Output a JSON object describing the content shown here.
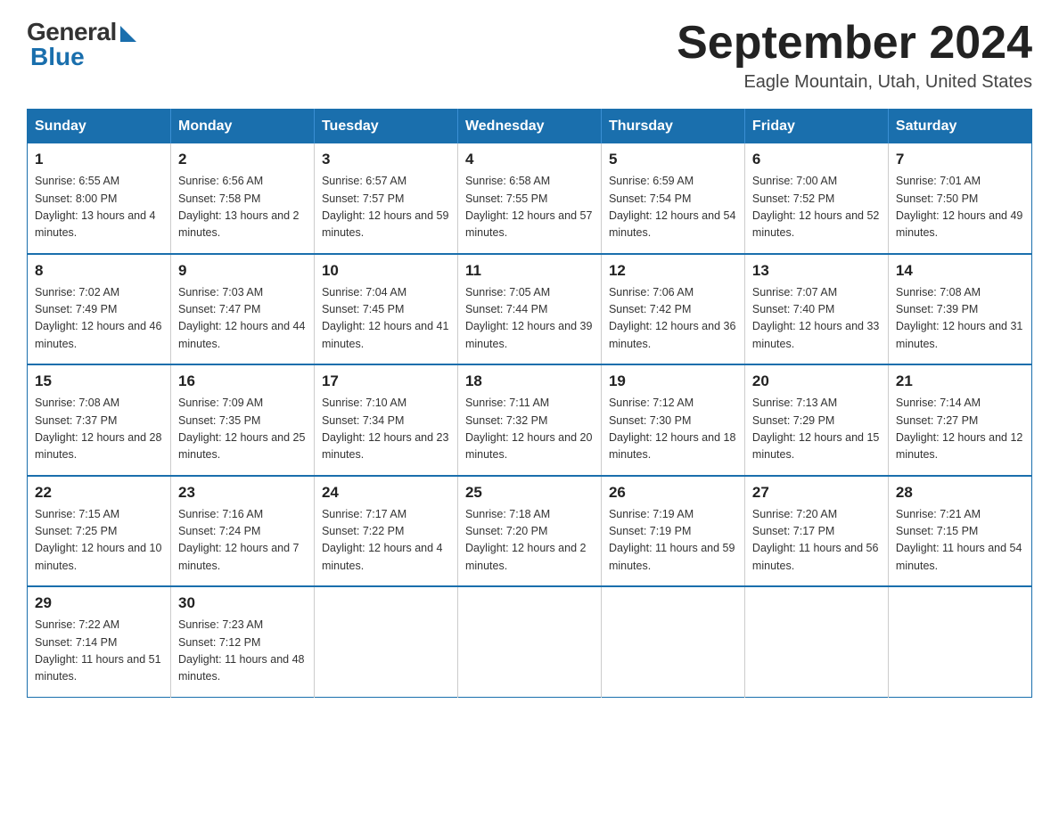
{
  "header": {
    "logo_general": "General",
    "logo_blue": "Blue",
    "month_title": "September 2024",
    "location": "Eagle Mountain, Utah, United States"
  },
  "days_of_week": [
    "Sunday",
    "Monday",
    "Tuesday",
    "Wednesday",
    "Thursday",
    "Friday",
    "Saturday"
  ],
  "weeks": [
    [
      {
        "day": "1",
        "sunrise": "6:55 AM",
        "sunset": "8:00 PM",
        "daylight": "13 hours and 4 minutes."
      },
      {
        "day": "2",
        "sunrise": "6:56 AM",
        "sunset": "7:58 PM",
        "daylight": "13 hours and 2 minutes."
      },
      {
        "day": "3",
        "sunrise": "6:57 AM",
        "sunset": "7:57 PM",
        "daylight": "12 hours and 59 minutes."
      },
      {
        "day": "4",
        "sunrise": "6:58 AM",
        "sunset": "7:55 PM",
        "daylight": "12 hours and 57 minutes."
      },
      {
        "day": "5",
        "sunrise": "6:59 AM",
        "sunset": "7:54 PM",
        "daylight": "12 hours and 54 minutes."
      },
      {
        "day": "6",
        "sunrise": "7:00 AM",
        "sunset": "7:52 PM",
        "daylight": "12 hours and 52 minutes."
      },
      {
        "day": "7",
        "sunrise": "7:01 AM",
        "sunset": "7:50 PM",
        "daylight": "12 hours and 49 minutes."
      }
    ],
    [
      {
        "day": "8",
        "sunrise": "7:02 AM",
        "sunset": "7:49 PM",
        "daylight": "12 hours and 46 minutes."
      },
      {
        "day": "9",
        "sunrise": "7:03 AM",
        "sunset": "7:47 PM",
        "daylight": "12 hours and 44 minutes."
      },
      {
        "day": "10",
        "sunrise": "7:04 AM",
        "sunset": "7:45 PM",
        "daylight": "12 hours and 41 minutes."
      },
      {
        "day": "11",
        "sunrise": "7:05 AM",
        "sunset": "7:44 PM",
        "daylight": "12 hours and 39 minutes."
      },
      {
        "day": "12",
        "sunrise": "7:06 AM",
        "sunset": "7:42 PM",
        "daylight": "12 hours and 36 minutes."
      },
      {
        "day": "13",
        "sunrise": "7:07 AM",
        "sunset": "7:40 PM",
        "daylight": "12 hours and 33 minutes."
      },
      {
        "day": "14",
        "sunrise": "7:08 AM",
        "sunset": "7:39 PM",
        "daylight": "12 hours and 31 minutes."
      }
    ],
    [
      {
        "day": "15",
        "sunrise": "7:08 AM",
        "sunset": "7:37 PM",
        "daylight": "12 hours and 28 minutes."
      },
      {
        "day": "16",
        "sunrise": "7:09 AM",
        "sunset": "7:35 PM",
        "daylight": "12 hours and 25 minutes."
      },
      {
        "day": "17",
        "sunrise": "7:10 AM",
        "sunset": "7:34 PM",
        "daylight": "12 hours and 23 minutes."
      },
      {
        "day": "18",
        "sunrise": "7:11 AM",
        "sunset": "7:32 PM",
        "daylight": "12 hours and 20 minutes."
      },
      {
        "day": "19",
        "sunrise": "7:12 AM",
        "sunset": "7:30 PM",
        "daylight": "12 hours and 18 minutes."
      },
      {
        "day": "20",
        "sunrise": "7:13 AM",
        "sunset": "7:29 PM",
        "daylight": "12 hours and 15 minutes."
      },
      {
        "day": "21",
        "sunrise": "7:14 AM",
        "sunset": "7:27 PM",
        "daylight": "12 hours and 12 minutes."
      }
    ],
    [
      {
        "day": "22",
        "sunrise": "7:15 AM",
        "sunset": "7:25 PM",
        "daylight": "12 hours and 10 minutes."
      },
      {
        "day": "23",
        "sunrise": "7:16 AM",
        "sunset": "7:24 PM",
        "daylight": "12 hours and 7 minutes."
      },
      {
        "day": "24",
        "sunrise": "7:17 AM",
        "sunset": "7:22 PM",
        "daylight": "12 hours and 4 minutes."
      },
      {
        "day": "25",
        "sunrise": "7:18 AM",
        "sunset": "7:20 PM",
        "daylight": "12 hours and 2 minutes."
      },
      {
        "day": "26",
        "sunrise": "7:19 AM",
        "sunset": "7:19 PM",
        "daylight": "11 hours and 59 minutes."
      },
      {
        "day": "27",
        "sunrise": "7:20 AM",
        "sunset": "7:17 PM",
        "daylight": "11 hours and 56 minutes."
      },
      {
        "day": "28",
        "sunrise": "7:21 AM",
        "sunset": "7:15 PM",
        "daylight": "11 hours and 54 minutes."
      }
    ],
    [
      {
        "day": "29",
        "sunrise": "7:22 AM",
        "sunset": "7:14 PM",
        "daylight": "11 hours and 51 minutes."
      },
      {
        "day": "30",
        "sunrise": "7:23 AM",
        "sunset": "7:12 PM",
        "daylight": "11 hours and 48 minutes."
      },
      null,
      null,
      null,
      null,
      null
    ]
  ]
}
